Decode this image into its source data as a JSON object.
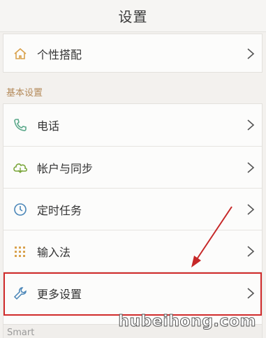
{
  "header": {
    "title": "设置"
  },
  "personal": {
    "label": "个性搭配"
  },
  "section_basic": {
    "label": "基本设置"
  },
  "basic_items": [
    {
      "label": "电话",
      "icon": "phone-icon"
    },
    {
      "label": "帐户与同步",
      "icon": "cloud-sync-icon"
    },
    {
      "label": "定时任务",
      "icon": "clock-icon"
    },
    {
      "label": "输入法",
      "icon": "keyboard-icon"
    },
    {
      "label": "更多设置",
      "icon": "wrench-icon"
    }
  ],
  "section_smart": {
    "label": "Smart"
  },
  "watermark": {
    "text": "hubeihong.com"
  },
  "colors": {
    "icon_green": "#5aa88a",
    "icon_orange": "#d9a24e",
    "highlight": "#d12b2b"
  }
}
